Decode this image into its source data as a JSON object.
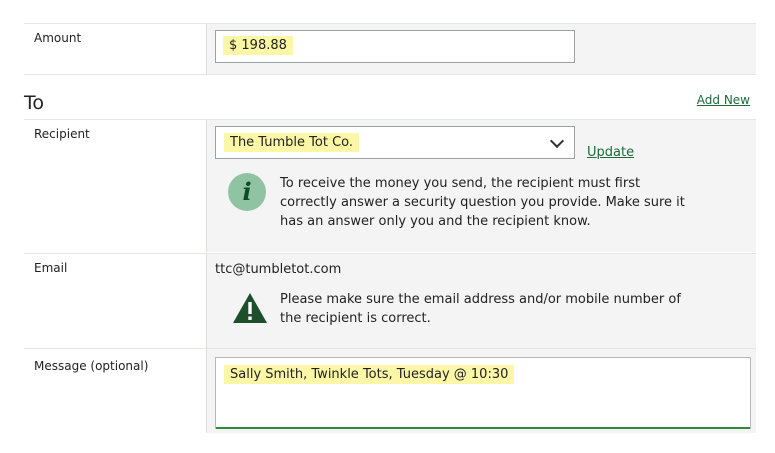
{
  "amount": {
    "label": "Amount",
    "value": "$ 198.88"
  },
  "to_section": {
    "title": "To",
    "add_new_label": "Add New"
  },
  "recipient": {
    "label": "Recipient",
    "selected": "The Tumble Tot Co.",
    "update_label": "Update",
    "info_lines": [
      "To receive the money you send, the recipient must first",
      "correctly answer a security question you provide. Make sure it",
      "has an answer only you and the recipient know."
    ]
  },
  "email": {
    "label": "Email",
    "value": "ttc@tumbletot.com",
    "warning_lines": [
      "Please make sure the email address and/or mobile number of",
      "the recipient is correct."
    ]
  },
  "message": {
    "label": "Message (optional)",
    "value": "Sally Smith, Twinkle Tots, Tuesday @ 10:30"
  },
  "icons": {
    "info": "info-icon",
    "warning": "warning-icon",
    "dropdown": "chevron-down-icon"
  },
  "colors": {
    "accent_green": "#1e6b3a",
    "highlight": "#fbf7a6",
    "panel_bg": "#f3f4f3",
    "focus_underline": "#2f8a3d"
  }
}
